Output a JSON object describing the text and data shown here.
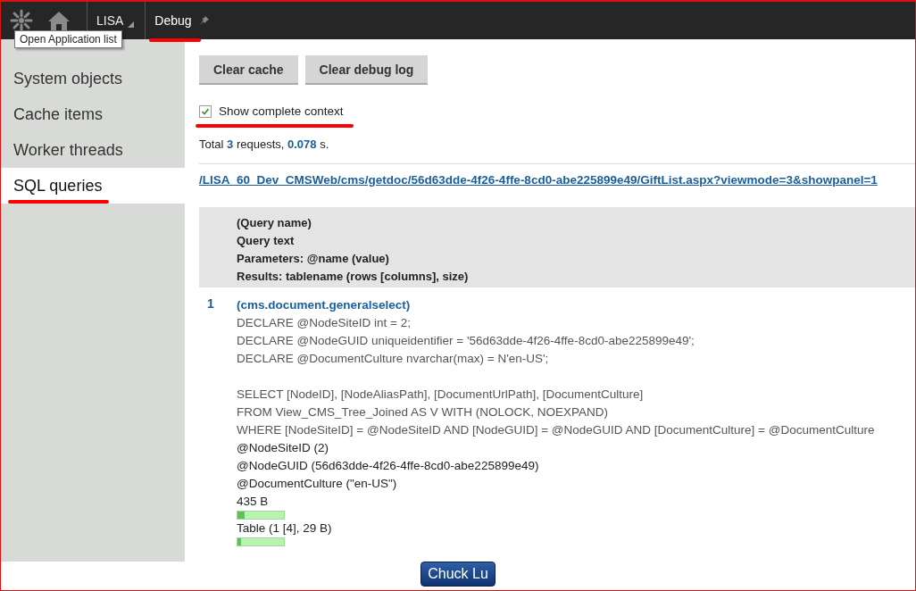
{
  "header": {
    "app_list_tooltip": "Open Application list",
    "site": "LISA",
    "tab": "Debug",
    "tab_pinned": false
  },
  "sidebar": {
    "items": [
      {
        "label": "System objects",
        "selected": false
      },
      {
        "label": "Cache items",
        "selected": false
      },
      {
        "label": "Worker threads",
        "selected": false
      },
      {
        "label": "SQL queries",
        "selected": true
      }
    ]
  },
  "buttons": [
    "Clear cache",
    "Clear debug log"
  ],
  "show_complete_context": {
    "label": "Show complete context",
    "checked": true
  },
  "summary": {
    "prefix": "Total ",
    "count": "3",
    "middle": " requests, ",
    "time": "0.078",
    "suffix": " s."
  },
  "request_url": "/LISA_60_Dev_CMSWeb/cms/getdoc/56d63dde-4f26-4ffe-8cd0-abe225899e49/GiftList.aspx?viewmode=3&showpanel=1",
  "table": {
    "header": [
      "(Query name)",
      "Query text",
      "Parameters: @name (value)",
      "Results: tablename (rows [columns], size)"
    ],
    "rows": [
      {
        "index": "1",
        "name": "(cms.document.generalselect)",
        "query_text": [
          [
            "DECLARE @NodeSiteID int = 2;",
            "DECLARE @NodeGUID uniqueidentifier = '56d63dde-4f26-4ffe-8cd0-abe225899e49';",
            "DECLARE @DocumentCulture nvarchar(max) = N'en-US';"
          ],
          [
            "SELECT [NodeID], [NodeAliasPath], [DocumentUrlPath], [DocumentCulture]",
            "FROM View_CMS_Tree_Joined AS V WITH (NOLOCK, NOEXPAND)",
            "WHERE [NodeSiteID] = @NodeSiteID AND [NodeGUID] = @NodeGUID AND [DocumentCulture] = @DocumentCulture"
          ]
        ],
        "parameters": [
          "@NodeSiteID (2)",
          "@NodeGUID (56d63dde-4f26-4ffe-8cd0-abe225899e49)",
          "@DocumentCulture (\"en-US\")"
        ],
        "results": [
          {
            "text": "435 B",
            "level": 0.15
          },
          {
            "text": "Table (1 [4], 29 B)",
            "level": 0.07
          }
        ]
      }
    ]
  },
  "footer_button": "Chuck Lu"
}
